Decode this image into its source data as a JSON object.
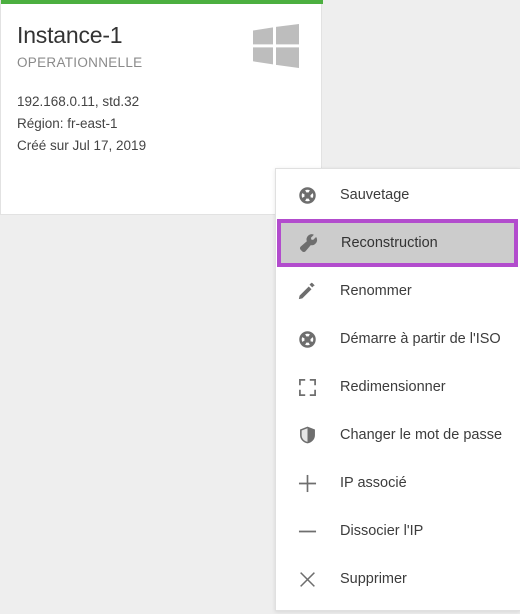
{
  "colors": {
    "accent_green": "#4caf40",
    "highlight_purple": "#b24ccd",
    "selected_row_bg": "#cccccc",
    "page_background": "#eeeeee",
    "card_background": "#ffffff",
    "icon_gray": "#6e6e6e",
    "logo_gray": "#bdbdbd"
  },
  "card": {
    "title": "Instance-1",
    "status": "OPERATIONNELLE",
    "os_icon": "windows-logo-icon",
    "meta": [
      "192.168.0.11, std.32",
      "Région: fr-east-1",
      "Créé sur Jul 17, 2019"
    ]
  },
  "context_menu": {
    "items": [
      {
        "label": "Sauvetage",
        "icon": "lifebuoy-icon",
        "selected": false
      },
      {
        "label": "Reconstruction",
        "icon": "wrench-icon",
        "selected": true
      },
      {
        "label": "Renommer",
        "icon": "pencil-icon",
        "selected": false
      },
      {
        "label": "Démarre à partir de l'ISO",
        "icon": "lifebuoy-icon",
        "selected": false
      },
      {
        "label": "Redimensionner",
        "icon": "resize-corners-icon",
        "selected": false
      },
      {
        "label": "Changer le mot de passe",
        "icon": "shield-icon",
        "selected": false
      },
      {
        "label": "IP associé",
        "icon": "plus-icon",
        "selected": false
      },
      {
        "label": "Dissocier l'IP",
        "icon": "minus-icon",
        "selected": false
      },
      {
        "label": "Supprimer",
        "icon": "close-x-icon",
        "selected": false
      }
    ]
  }
}
